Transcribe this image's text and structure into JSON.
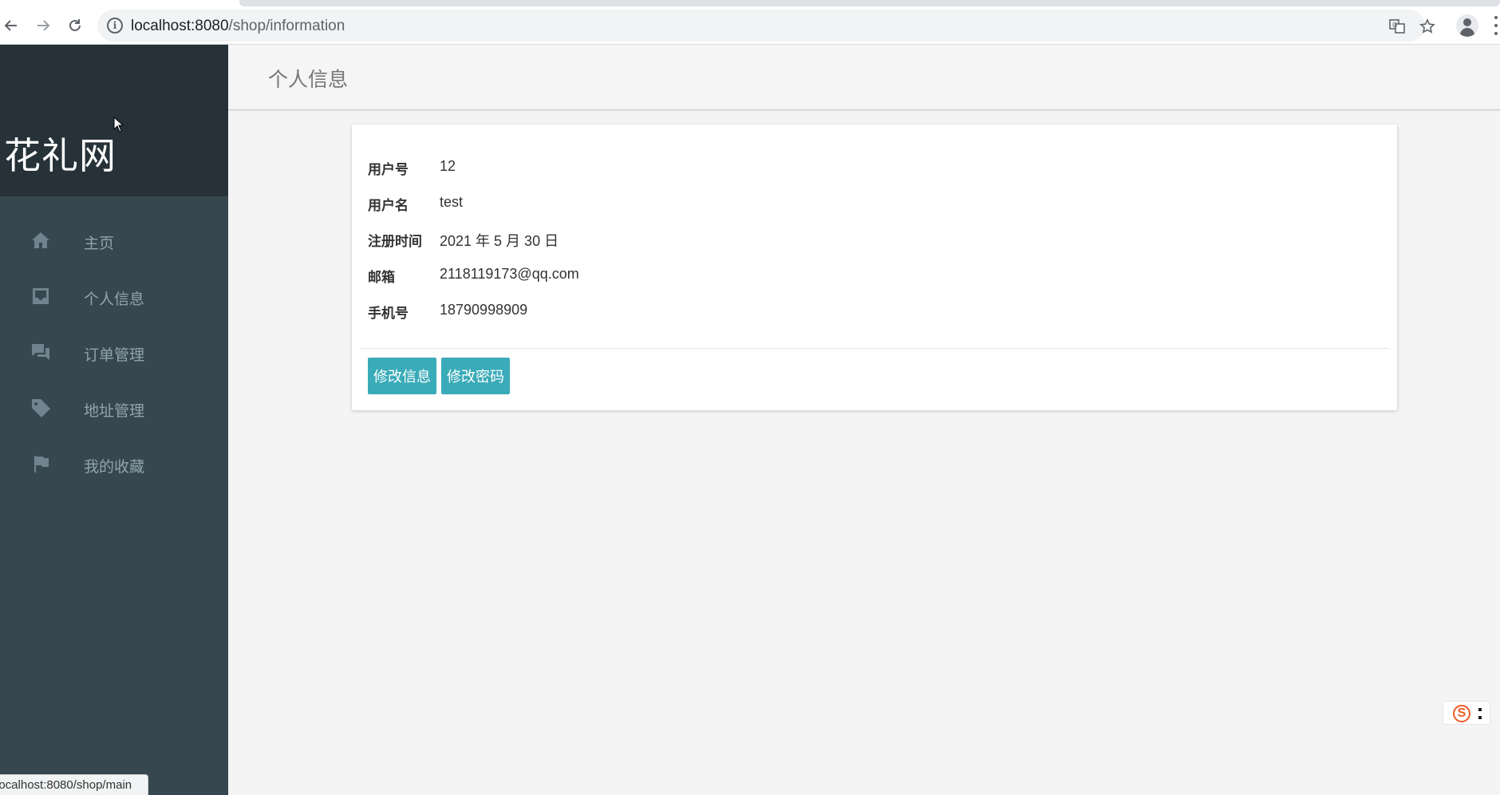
{
  "browser": {
    "url_host": "localhost:8080",
    "url_path": "/shop/information",
    "status_url": "localhost:8080/shop/main"
  },
  "sidebar": {
    "brand": "花礼网",
    "items": [
      {
        "label": "主页",
        "icon": "home-icon"
      },
      {
        "label": "个人信息",
        "icon": "inbox-icon"
      },
      {
        "label": "订单管理",
        "icon": "chat-icon"
      },
      {
        "label": "地址管理",
        "icon": "tag-icon"
      },
      {
        "label": "我的收藏",
        "icon": "flag-icon"
      }
    ]
  },
  "header": {
    "title": "个人信息"
  },
  "profile": {
    "rows": [
      {
        "key": "用户号",
        "value": "12"
      },
      {
        "key": "用户名",
        "value": "test"
      },
      {
        "key": "注册时间",
        "value": "2021 年 5 月 30 日"
      },
      {
        "key": "邮箱",
        "value": "2118119173@qq.com"
      },
      {
        "key": "手机号",
        "value": "18790998909"
      }
    ],
    "edit_button": "修改信息",
    "password_button": "修改密码"
  },
  "colors": {
    "sidebar_bg": "#37474f",
    "brand_bg": "#263238",
    "accent": "#3aabb8",
    "menu_text": "#90a4ae"
  }
}
